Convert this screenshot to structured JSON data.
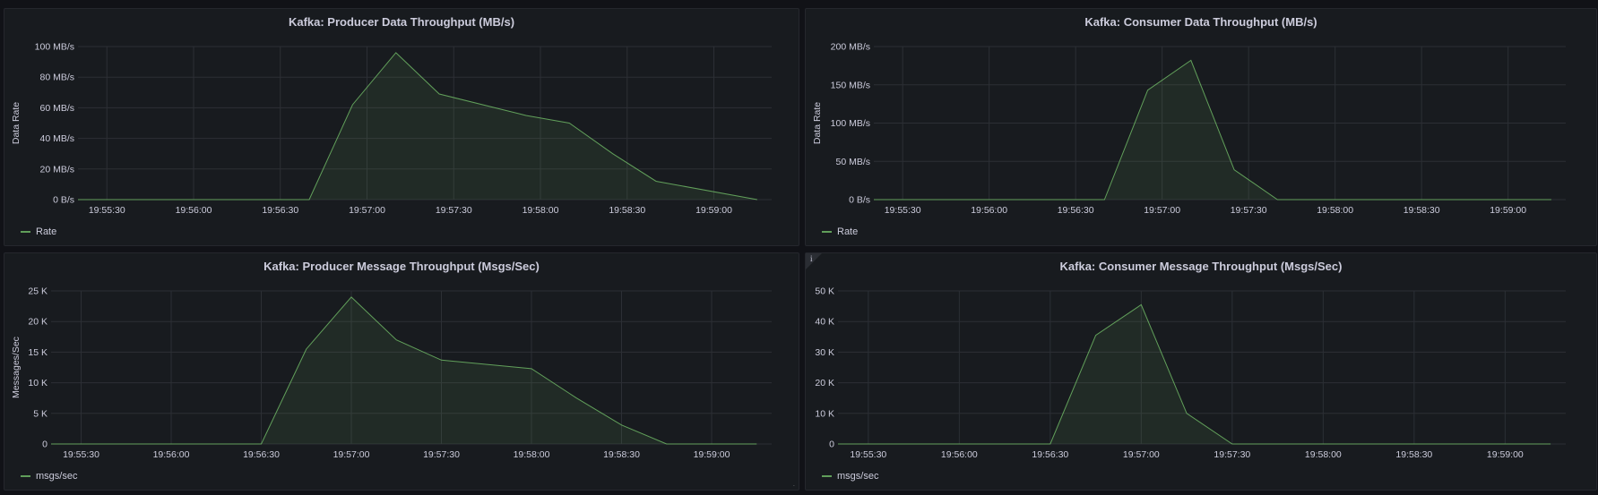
{
  "colors": {
    "series": "#73bf69",
    "grid": "#2c2f35",
    "text": "#ccccdc"
  },
  "panels": [
    {
      "id": "p1",
      "title": "Kafka: Producer Data Throughput (MB/s)",
      "legend": "Rate",
      "info_icon": "",
      "chart": {
        "type": "area",
        "ylabel": "Data Rate",
        "xlabel": "",
        "x_ticks": [
          "19:55:30",
          "19:56:00",
          "19:56:30",
          "19:57:00",
          "19:57:30",
          "19:58:00",
          "19:58:30",
          "19:59:00"
        ],
        "y_ticks": [
          {
            "v": 0,
            "label": "0 B/s"
          },
          {
            "v": 20,
            "label": "20 MB/s"
          },
          {
            "v": 40,
            "label": "40 MB/s"
          },
          {
            "v": 60,
            "label": "60 MB/s"
          },
          {
            "v": 80,
            "label": "80 MB/s"
          },
          {
            "v": 100,
            "label": "100 MB/s"
          }
        ],
        "ylim": [
          0,
          100
        ],
        "xlim_sec": [
          -10,
          230
        ],
        "series": [
          {
            "name": "Rate",
            "x": [
              "19:55:20",
              "19:56:40",
              "19:56:55",
              "19:57:10",
              "19:57:25",
              "19:57:55",
              "19:58:10",
              "19:58:25",
              "19:58:40",
              "19:59:15"
            ],
            "values": [
              0,
              0,
              62,
              96,
              69,
              55,
              50,
              30,
              12,
              0
            ]
          }
        ]
      }
    },
    {
      "id": "p2",
      "title": "Kafka: Consumer Data Throughput (MB/s)",
      "legend": "Rate",
      "info_icon": "",
      "chart": {
        "type": "area",
        "ylabel": "Data Rate",
        "xlabel": "",
        "x_ticks": [
          "19:55:30",
          "19:56:00",
          "19:56:30",
          "19:57:00",
          "19:57:30",
          "19:58:00",
          "19:58:30",
          "19:59:00"
        ],
        "y_ticks": [
          {
            "v": 0,
            "label": "0 B/s"
          },
          {
            "v": 50,
            "label": "50 MB/s"
          },
          {
            "v": 100,
            "label": "100 MB/s"
          },
          {
            "v": 150,
            "label": "150 MB/s"
          },
          {
            "v": 200,
            "label": "200 MB/s"
          }
        ],
        "ylim": [
          0,
          200
        ],
        "xlim_sec": [
          -10,
          230
        ],
        "series": [
          {
            "name": "Rate",
            "x": [
              "19:55:20",
              "19:56:40",
              "19:56:55",
              "19:57:10",
              "19:57:25",
              "19:57:40",
              "19:59:15"
            ],
            "values": [
              0,
              0,
              143,
              182,
              39,
              0,
              0
            ]
          }
        ]
      }
    },
    {
      "id": "p3",
      "title": "Kafka: Producer Message Throughput (Msgs/Sec)",
      "legend": "msgs/sec",
      "info_icon": "",
      "chart": {
        "type": "area",
        "ylabel": "Messages/Sec",
        "xlabel": "",
        "x_ticks": [
          "19:55:30",
          "19:56:00",
          "19:56:30",
          "19:57:00",
          "19:57:30",
          "19:58:00",
          "19:58:30",
          "19:59:00"
        ],
        "y_ticks": [
          {
            "v": 0,
            "label": "0"
          },
          {
            "v": 5000,
            "label": "5 K"
          },
          {
            "v": 10000,
            "label": "10 K"
          },
          {
            "v": 15000,
            "label": "15 K"
          },
          {
            "v": 20000,
            "label": "20 K"
          },
          {
            "v": 25000,
            "label": "25 K"
          }
        ],
        "ylim": [
          0,
          25000
        ],
        "xlim_sec": [
          -10,
          230
        ],
        "series": [
          {
            "name": "msgs/sec",
            "x": [
              "19:55:20",
              "19:56:30",
              "19:56:45",
              "19:57:00",
              "19:57:15",
              "19:57:30",
              "19:58:00",
              "19:58:15",
              "19:58:30",
              "19:58:45",
              "19:59:15"
            ],
            "values": [
              0,
              0,
              15500,
              24000,
              17000,
              13700,
              12300,
              7500,
              3100,
              0,
              0
            ]
          }
        ]
      }
    },
    {
      "id": "p4",
      "title": "Kafka: Consumer Message Throughput (Msgs/Sec)",
      "legend": "msgs/sec",
      "info_icon": "i",
      "chart": {
        "type": "area",
        "ylabel": "",
        "xlabel": "",
        "x_ticks": [
          "19:55:30",
          "19:56:00",
          "19:56:30",
          "19:57:00",
          "19:57:30",
          "19:58:00",
          "19:58:30",
          "19:59:00"
        ],
        "y_ticks": [
          {
            "v": 0,
            "label": "0"
          },
          {
            "v": 10000,
            "label": "10 K"
          },
          {
            "v": 20000,
            "label": "20 K"
          },
          {
            "v": 30000,
            "label": "30 K"
          },
          {
            "v": 40000,
            "label": "40 K"
          },
          {
            "v": 50000,
            "label": "50 K"
          }
        ],
        "ylim": [
          0,
          50000
        ],
        "xlim_sec": [
          -10,
          230
        ],
        "series": [
          {
            "name": "msgs/sec",
            "x": [
              "19:55:20",
              "19:56:30",
              "19:56:45",
              "19:57:00",
              "19:57:15",
              "19:57:30",
              "19:59:15"
            ],
            "values": [
              0,
              0,
              35500,
              45500,
              10000,
              0,
              0
            ]
          }
        ]
      }
    }
  ]
}
